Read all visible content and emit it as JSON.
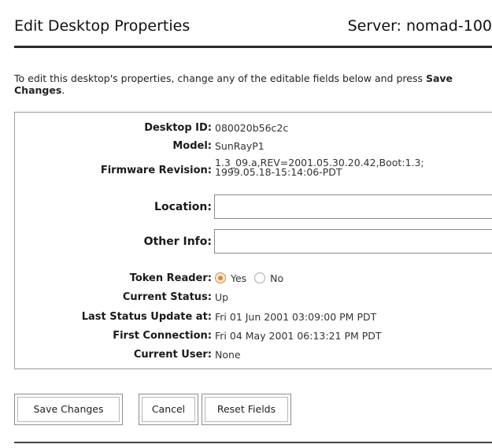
{
  "header": {
    "title": "Edit Desktop Properties",
    "server": "Server: nomad-100"
  },
  "intro": {
    "text_before": "To edit this desktop's properties, change any of the editable fields below and press ",
    "emphasis": "Save Changes",
    "text_after": "."
  },
  "properties": {
    "desktop_id": {
      "label": "Desktop ID:",
      "value": "080020b56c2c"
    },
    "model": {
      "label": "Model:",
      "value": "SunRayP1"
    },
    "firmware": {
      "label": "Firmware Revision:",
      "value_line1": "1.3_09.a,REV=2001.05.30.20.42,Boot:1.3;",
      "value_line2": "1999.05.18-15:14:06-PDT"
    },
    "location": {
      "label": "Location:",
      "value": "",
      "placeholder": ""
    },
    "other_info": {
      "label": "Other Info:",
      "value": "",
      "placeholder": ""
    },
    "token_reader": {
      "label": "Token Reader:",
      "options": [
        "Yes",
        "No"
      ],
      "selected": "Yes"
    },
    "current_status": {
      "label": "Current Status:",
      "value": "Up"
    },
    "last_status_update": {
      "label": "Last Status Update at:",
      "value": "Fri 01 Jun 2001 03:09:00 PM PDT"
    },
    "first_connection": {
      "label": "First Connection:",
      "value": "Fri 04 May 2001 06:13:21 PM PDT"
    },
    "current_user": {
      "label": "Current User:",
      "value": "None"
    }
  },
  "buttons": {
    "save": "Save Changes",
    "cancel": "Cancel",
    "reset": "Reset Fields"
  },
  "colors": {
    "radio_selected": "#e8862a",
    "rule": "#2a2a2a"
  }
}
